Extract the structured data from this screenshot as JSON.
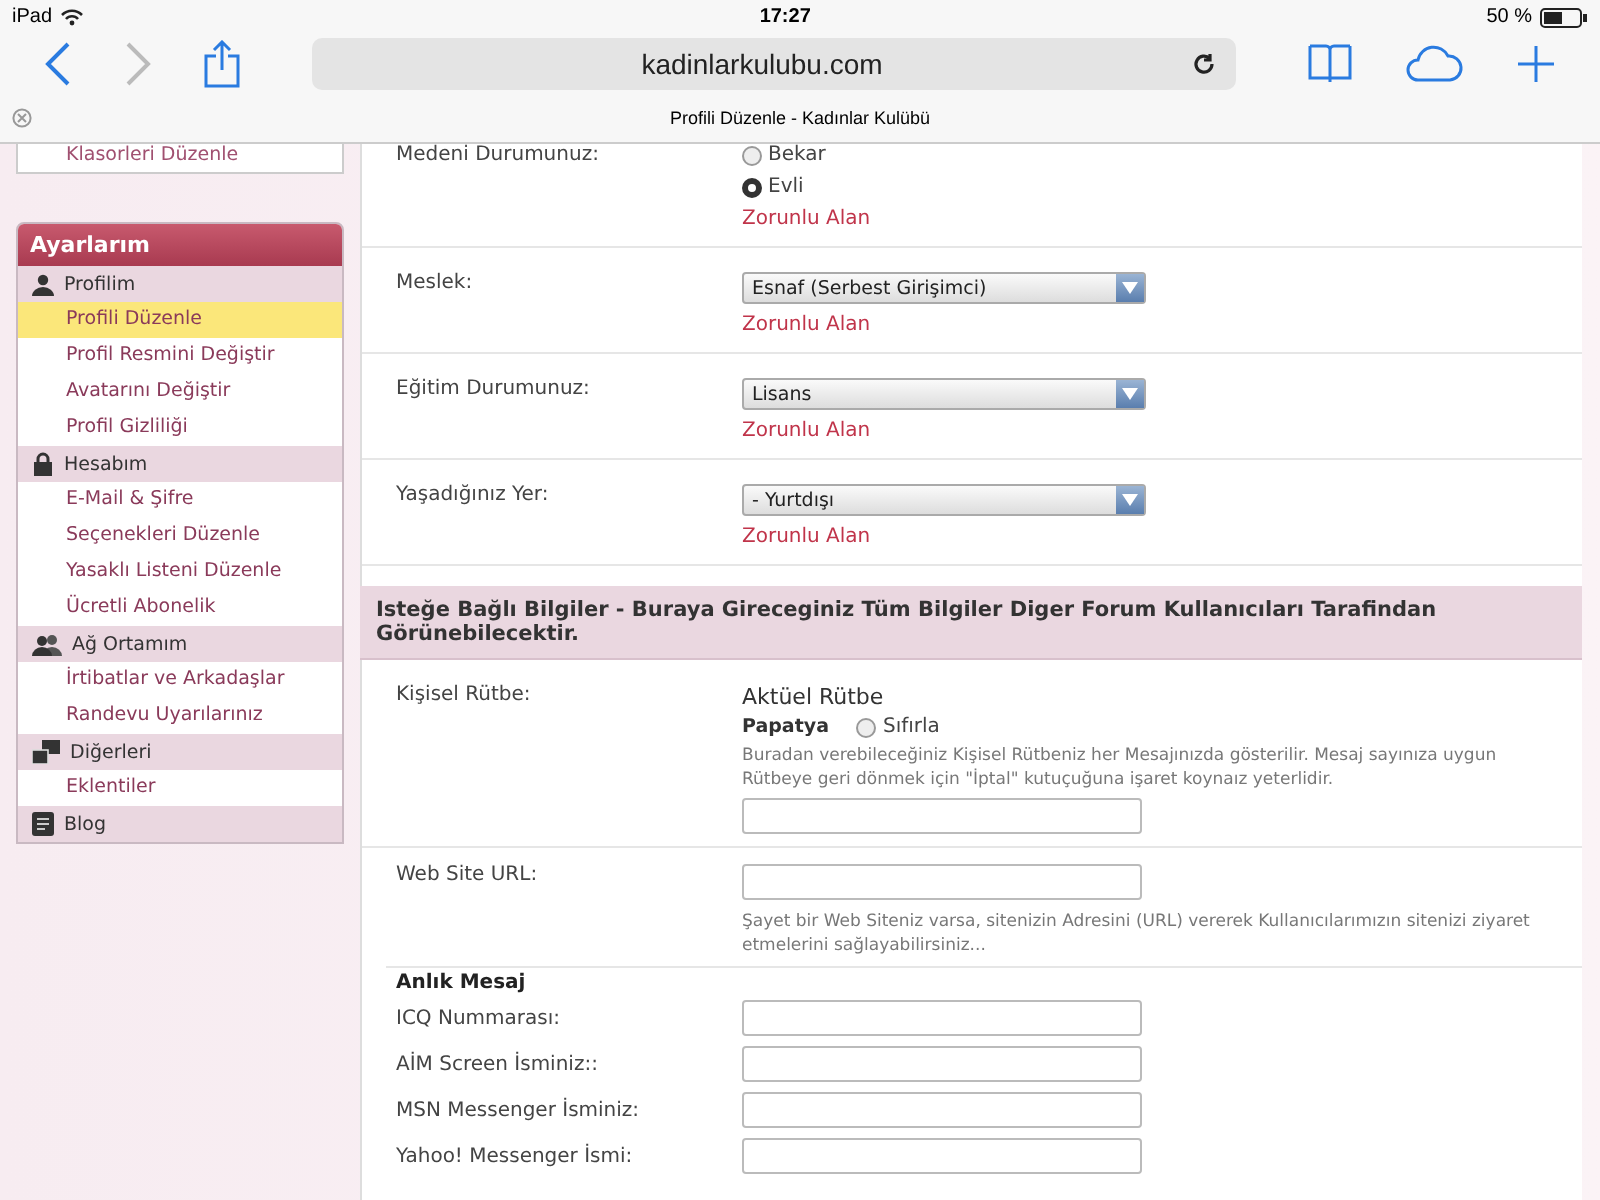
{
  "status_bar": {
    "device": "iPad",
    "time": "17:27",
    "battery": "50 %"
  },
  "browser": {
    "url": "kadinlarkulubu.com",
    "tab_title": "Profili Düzenle - Kadınlar Kulübü"
  },
  "sidebar": {
    "top_item": "Klasorleri Düzenle",
    "title": "Ayarlarım",
    "groups": [
      {
        "label": "Profilim",
        "items": [
          {
            "label": "Profili Düzenle",
            "selected": true
          },
          {
            "label": "Profil Resmini Değiştir",
            "selected": false
          },
          {
            "label": "Avatarını Değiştir",
            "selected": false
          },
          {
            "label": "Profil Gizliliği",
            "selected": false
          }
        ]
      },
      {
        "label": "Hesabım",
        "items": [
          {
            "label": "E-Mail & Şifre",
            "selected": false
          },
          {
            "label": "Seçenekleri Düzenle",
            "selected": false
          },
          {
            "label": "Yasaklı Listeni Düzenle",
            "selected": false
          },
          {
            "label": "Ücretli Abonelik",
            "selected": false
          }
        ]
      },
      {
        "label": "Ağ Ortamım",
        "items": [
          {
            "label": "İrtibatlar ve Arkadaşlar",
            "selected": false
          },
          {
            "label": "Randevu Uyarılarınız",
            "selected": false
          }
        ]
      },
      {
        "label": "Diğerleri",
        "items": [
          {
            "label": "Eklentiler",
            "selected": false
          }
        ]
      },
      {
        "label": "Blog"
      }
    ]
  },
  "required_fields": [
    {
      "kind": "radio",
      "label": "Medeni Durumunuz:",
      "options": [
        {
          "label": "Bekar",
          "selected": false
        },
        {
          "label": "Evli",
          "selected": true
        }
      ],
      "note": "Zorunlu Alan"
    },
    {
      "kind": "select",
      "label": "Meslek:",
      "value": "Esnaf (Serbest Girişimci)",
      "note": "Zorunlu Alan"
    },
    {
      "kind": "select",
      "label": "Eğitim Durumunuz:",
      "value": "Lisans",
      "note": "Zorunlu Alan"
    },
    {
      "kind": "select",
      "label": "Yaşadığınız Yer:",
      "value": "- Yurtdışı",
      "note": "Zorunlu Alan"
    }
  ],
  "optional_section": {
    "heading": "Isteğe Bağlı Bilgiler - Buraya Gireceginiz Tüm Bilgiler Diger Forum Kullanıcıları Tarafindan Görünebilecektir.",
    "rank": {
      "label": "Kişisel Rütbe:",
      "current_title": "Aktüel Rütbe",
      "rank_name": "Papatya",
      "reset": {
        "label": "Sıfırla",
        "selected": false
      },
      "help": "Buradan verebileceğiniz Kişisel Rütbeniz her Mesajınızda gösterilir. Mesaj sayınıza uygun Rütbeye geri dönmek için \"İptal\" kutuçuğuna işaret koynaız yeterlidir."
    },
    "website": {
      "label": "Web Site URL:",
      "help": "Şayet bir Web Siteniz varsa, sitenizin Adresini (URL) vererek Kullanıcılarımızın sitenizi ziyaret etmelerini sağlayabilirsiniz..."
    }
  },
  "instant_message": {
    "heading": "Anlık Mesaj",
    "fields": [
      {
        "label": "ICQ Nummarası:"
      },
      {
        "label": "AİM Screen İsminiz::"
      },
      {
        "label": "MSN Messenger İsminiz:"
      },
      {
        "label": "Yahoo! Messenger İsmi:"
      }
    ]
  }
}
